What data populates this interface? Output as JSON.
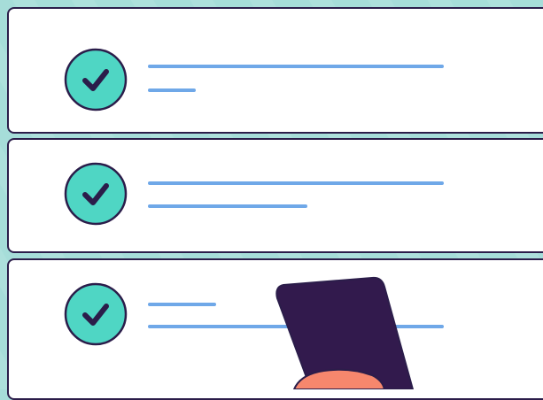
{
  "colors": {
    "background": "#a6ddd9",
    "card_bg": "#ffffff",
    "outline": "#2b1d4a",
    "check_fill": "#4fd6c4",
    "line": "#6fa8e8",
    "phone": "#321a4d",
    "hand": "#f6876d"
  },
  "icons": {
    "check": "check-circle-icon",
    "phone": "phone-icon",
    "hand": "hand-icon"
  },
  "items": [
    {
      "icon": "check-circle-icon",
      "state": "checked"
    },
    {
      "icon": "check-circle-icon",
      "state": "checked"
    },
    {
      "icon": "check-circle-icon",
      "state": "checked"
    }
  ]
}
